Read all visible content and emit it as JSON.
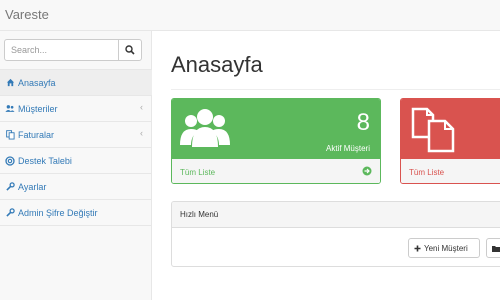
{
  "app": {
    "brand": "Vareste"
  },
  "search": {
    "placeholder": "Search..."
  },
  "sidebar": {
    "items": [
      {
        "label": "Anasayfa",
        "icon": "home-icon"
      },
      {
        "label": "Müşteriler",
        "icon": "users-icon"
      },
      {
        "label": "Faturalar",
        "icon": "copy-icon"
      },
      {
        "label": "Destek Talebi",
        "icon": "support-icon"
      },
      {
        "label": "Ayarlar",
        "icon": "wrench-icon"
      },
      {
        "label": "Admin Şifre Değiştir",
        "icon": "wrench-icon"
      }
    ]
  },
  "main": {
    "title": "Anasayfa",
    "panels": {
      "customers": {
        "count": "8",
        "label": "Aktif Müşteri",
        "link": "Tüm Liste",
        "color": "#5cb85c"
      },
      "invoices": {
        "link": "Tüm Liste",
        "color": "#d9534f"
      }
    },
    "quick_menu": {
      "title": "Hızlı Menü",
      "new_customer": "Yeni Müşteri"
    }
  }
}
